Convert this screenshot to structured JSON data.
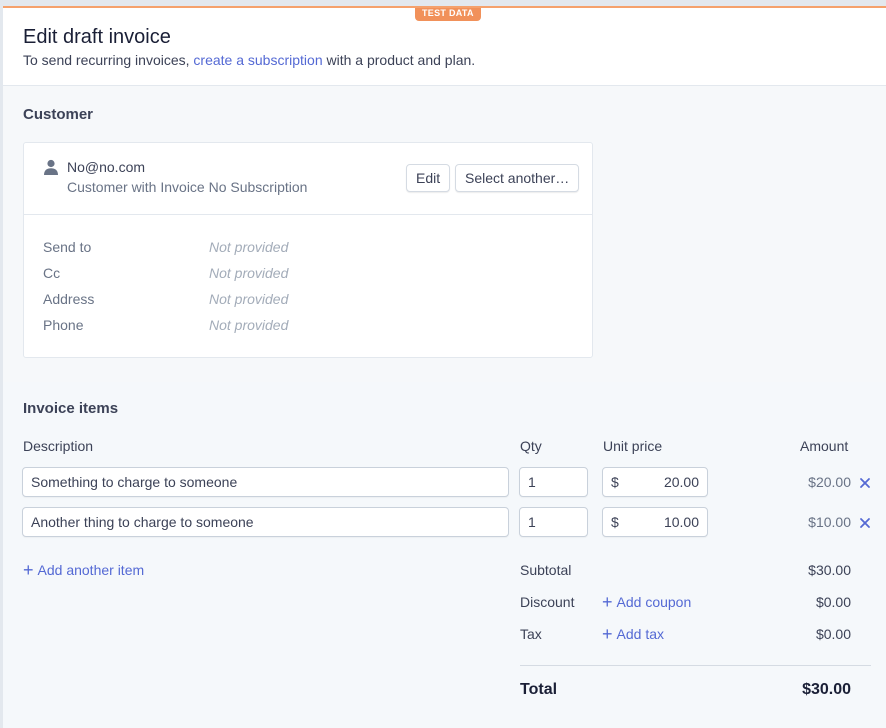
{
  "badge": "TEST DATA",
  "header": {
    "title": "Edit draft invoice",
    "subtitle_before": "To send recurring invoices,",
    "subtitle_link": "create a subscription",
    "subtitle_after": "with a product and plan."
  },
  "customer": {
    "section_title": "Customer",
    "email": "No@no.com",
    "description": "Customer with Invoice No Subscription",
    "edit_label": "Edit",
    "select_label": "Select another…",
    "fields": [
      {
        "label": "Send to",
        "value": "Not provided"
      },
      {
        "label": "Cc",
        "value": "Not provided"
      },
      {
        "label": "Address",
        "value": "Not provided"
      },
      {
        "label": "Phone",
        "value": "Not provided"
      }
    ]
  },
  "items": {
    "section_title": "Invoice items",
    "columns": {
      "description": "Description",
      "qty": "Qty",
      "unit_price": "Unit price",
      "amount": "Amount"
    },
    "rows": [
      {
        "description": "Something to charge to someone",
        "qty": "1",
        "currency": "$",
        "unit_price": "20.00",
        "amount": "$20.00"
      },
      {
        "description": "Another thing to charge to someone",
        "qty": "1",
        "currency": "$",
        "unit_price": "10.00",
        "amount": "$10.00"
      }
    ],
    "add_item_label": "Add another item"
  },
  "summary": {
    "subtotal_label": "Subtotal",
    "subtotal_value": "$30.00",
    "discount_label": "Discount",
    "discount_link": "Add coupon",
    "discount_value": "$0.00",
    "tax_label": "Tax",
    "tax_link": "Add tax",
    "tax_value": "$0.00",
    "total_label": "Total",
    "total_value": "$30.00"
  },
  "colors": {
    "accent": "#5469d4",
    "badge": "#f1915a"
  }
}
